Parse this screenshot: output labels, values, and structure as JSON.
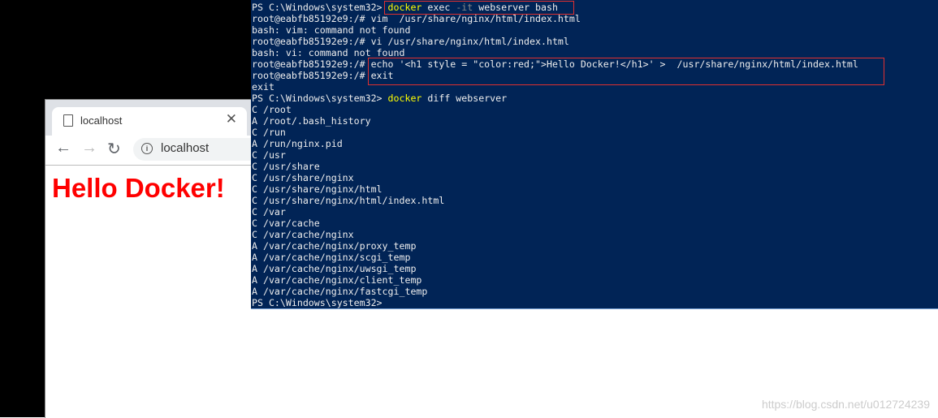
{
  "browser": {
    "tab_title": "localhost",
    "url": "localhost",
    "heading": "Hello Docker!"
  },
  "terminal": {
    "cmd1_prompt": "PS C:\\Windows\\system32> ",
    "cmd1_a": "docker",
    "cmd1_b": " exec ",
    "cmd1_c": "-it",
    "cmd1_d": " webserver bash",
    "mid_lines": [
      "root@eabfb85192e9:/# vim  /usr/share/nginx/html/index.html",
      "bash: vim: command not found",
      "root@eabfb85192e9:/# vi /usr/share/nginx/html/index.html",
      "bash: vi: command not found",
      "root@eabfb85192e9:/# echo '<h1 style = \"color:red;\">Hello Docker!</h1>' >  /usr/share/nginx/html/index.html",
      "root@eabfb85192e9:/# exit",
      "exit"
    ],
    "cmd2_prompt": "PS C:\\Windows\\system32> ",
    "cmd2_a": "docker",
    "cmd2_b": " diff webserver",
    "diff_lines": [
      "C /root",
      "A /root/.bash_history",
      "C /run",
      "A /run/nginx.pid",
      "C /usr",
      "C /usr/share",
      "C /usr/share/nginx",
      "C /usr/share/nginx/html",
      "C /usr/share/nginx/html/index.html",
      "C /var",
      "C /var/cache",
      "C /var/cache/nginx",
      "A /var/cache/nginx/proxy_temp",
      "A /var/cache/nginx/scgi_temp",
      "A /var/cache/nginx/uwsgi_temp",
      "A /var/cache/nginx/client_temp",
      "A /var/cache/nginx/fastcgi_temp"
    ],
    "final_prompt": "PS C:\\Windows\\system32>"
  },
  "watermark": "https://blog.csdn.net/u012724239"
}
